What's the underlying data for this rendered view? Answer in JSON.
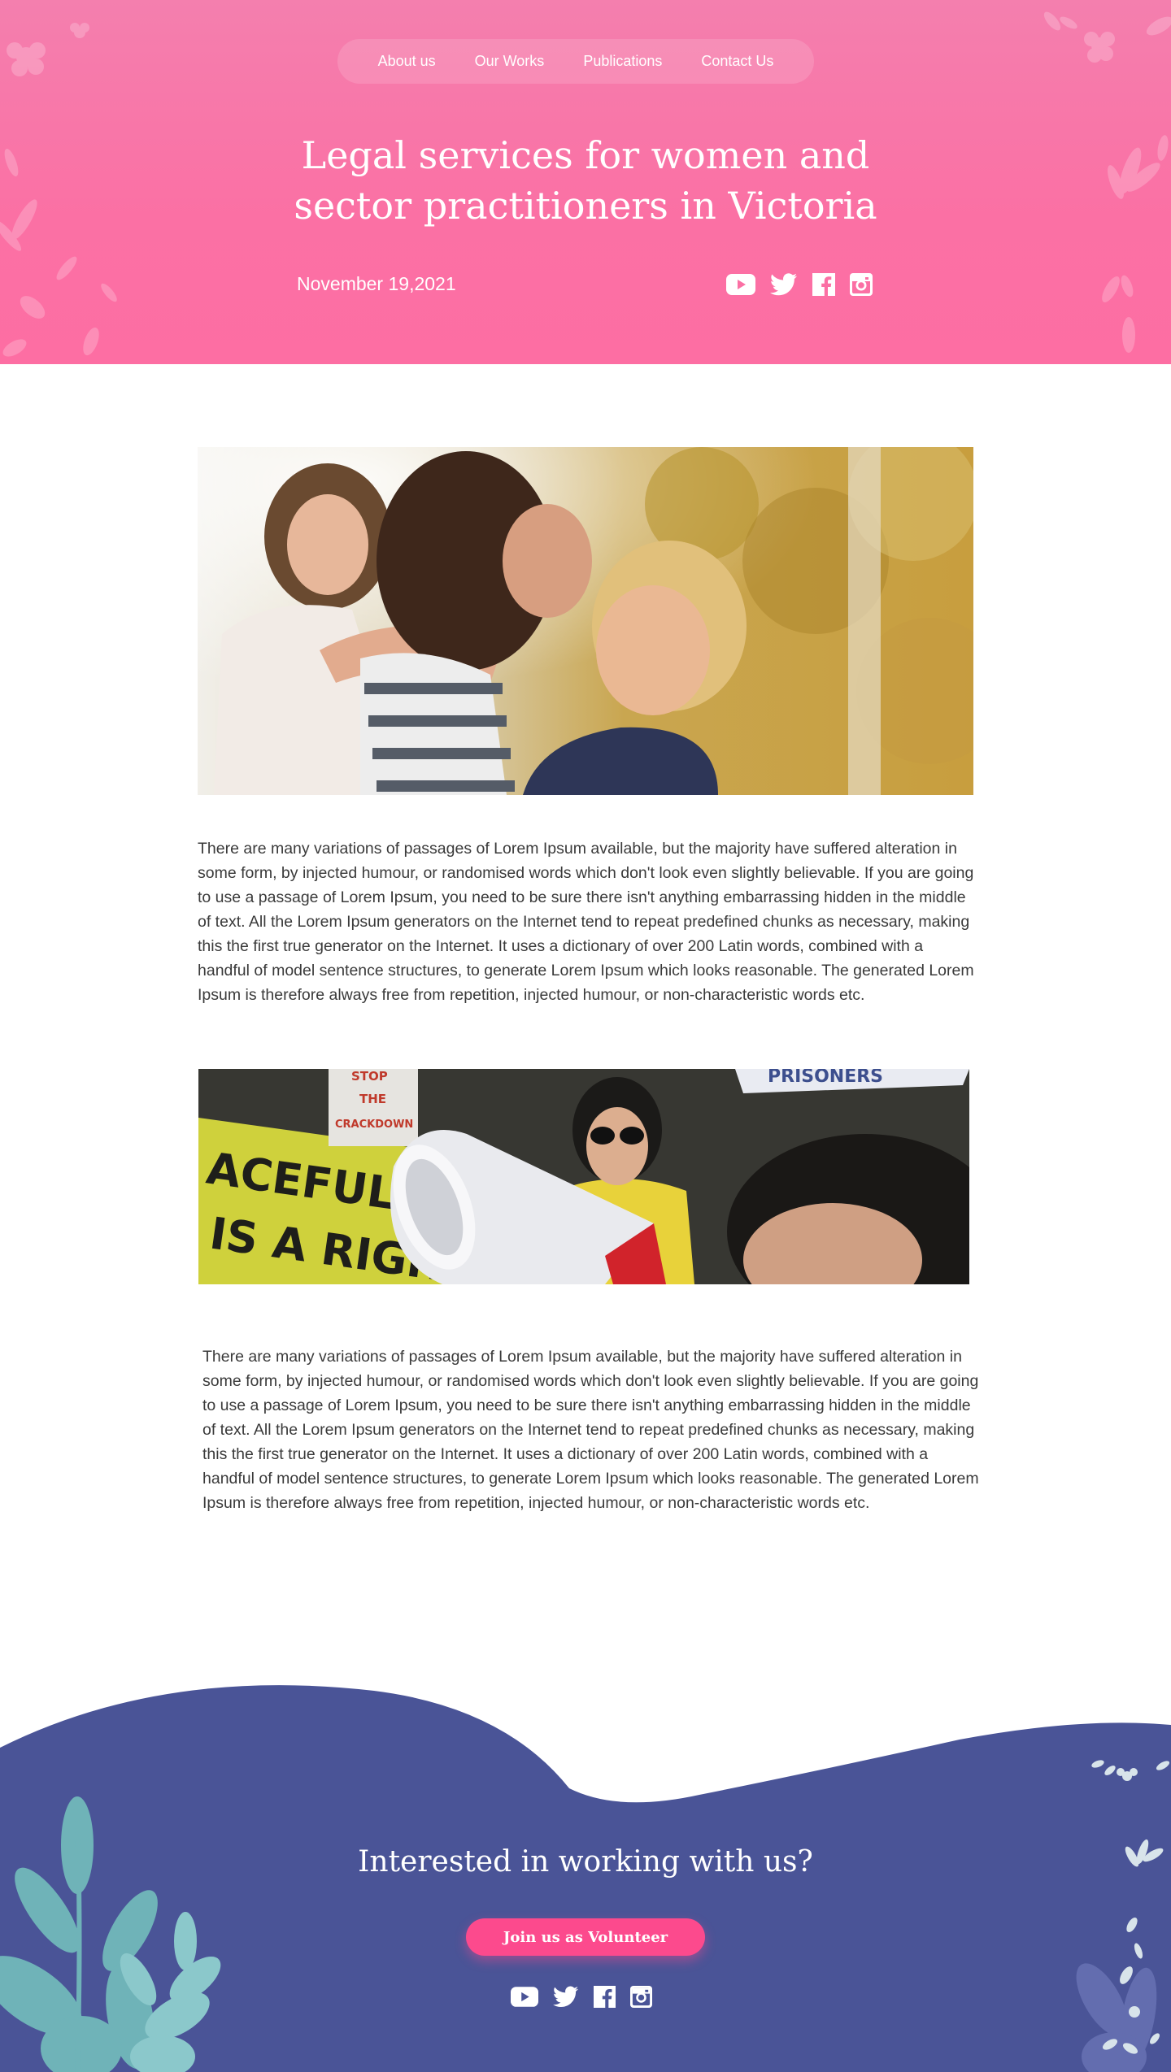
{
  "nav": {
    "items": [
      {
        "label": "About us"
      },
      {
        "label": "Our Works"
      },
      {
        "label": "Publications"
      },
      {
        "label": "Contact Us"
      }
    ]
  },
  "hero": {
    "title": "Legal services for women and sector practitioners in Victoria",
    "date": "November 19,2021",
    "social_icons": [
      "youtube-icon",
      "twitter-icon",
      "facebook-icon",
      "instagram-icon"
    ]
  },
  "article": {
    "paragraph_1": "There are many variations of passages of Lorem Ipsum available, but the majority have suffered alteration in some form, by injected humour, or randomised words which don't look even slightly believable. If you are going to use a passage of Lorem Ipsum, you need to be sure there isn't anything embarrassing hidden in the middle of text. All the Lorem Ipsum generators on the Internet tend to repeat predefined chunks as necessary, making this the first true generator on the Internet. It uses a dictionary of over 200 Latin words, combined with a handful of model sentence structures, to generate Lorem Ipsum which looks reasonable. The generated Lorem Ipsum is therefore always free from repetition, injected humour, or non-characteristic words etc.",
    "paragraph_2": "There are many variations of passages of Lorem Ipsum available, but the majority have suffered alteration in some form, by injected humour, or randomised words which don't look even slightly believable. If you are going to use a passage of Lorem Ipsum, you need to be sure there isn't anything embarrassing hidden in the middle of text. All the Lorem Ipsum generators on the Internet tend to repeat predefined chunks as necessary, making this the first true generator on the Internet. It uses a dictionary of over 200 Latin words, combined with a handful of model sentence structures, to generate Lorem Ipsum which looks reasonable. The generated Lorem Ipsum is therefore always free from repetition, injected humour, or non-characteristic words etc.",
    "photo_2_sign_text": {
      "banner_line_1": "ACEFUL PRO",
      "banner_line_2": "IS A RIGHT",
      "sign_line_1": "STOP",
      "sign_line_2": "THE",
      "sign_line_3": "CRACKDOWN",
      "top_sign": "PRISONERS"
    }
  },
  "footer": {
    "title": "Interested in working with us?",
    "button_label": "Join us as Volunteer",
    "social_icons": [
      "youtube-icon",
      "twitter-icon",
      "facebook-icon",
      "instagram-icon"
    ]
  },
  "colors": {
    "hero_pink": "#fb70a4",
    "footer_indigo": "#4a5497",
    "button_pink": "#fc4a8d",
    "leaf_teal": "#6fb3b8",
    "text": "#3a3a3a"
  }
}
